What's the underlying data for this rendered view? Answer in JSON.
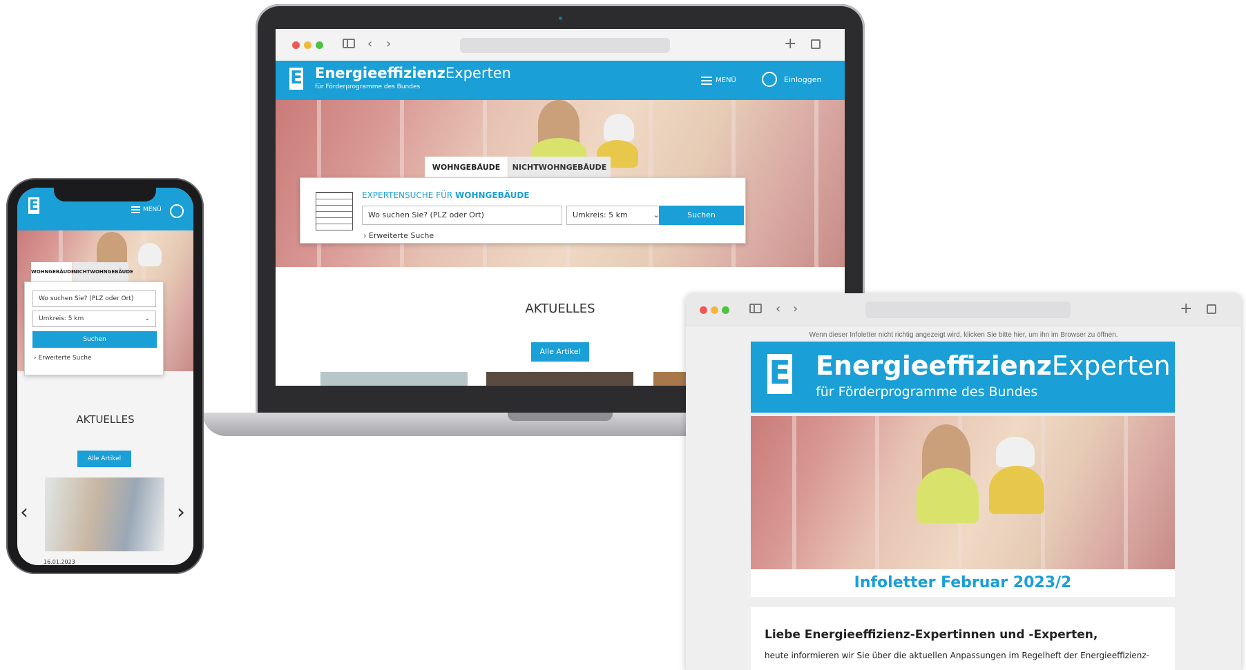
{
  "laptop": {
    "brand_bold": "Energieeffizienz",
    "brand_rest": "Experten",
    "brand_sub": "für Förderprogramme des Bundes",
    "menu_label": "MENÜ",
    "login_label": "Einloggen",
    "tab_residential": "WOHNGEBÄUDE",
    "tab_nonresidential": "NICHTWOHNGEBÄUDE",
    "search_title_prefix": "EXPERTENSUCHE FÜR ",
    "search_title_bold": "WOHNGEBÄUDE",
    "location_placeholder": "Wo suchen Sie? (PLZ oder Ort)",
    "radius_value": "Umkreis: 5 km",
    "search_button": "Suchen",
    "advanced_search": "Erweiterte Suche",
    "news_heading": "AKTUELLES",
    "all_articles": "Alle Artikel"
  },
  "phone": {
    "menu_label": "MENÜ",
    "tab_residential": "WOHNGEBÄUDE",
    "tab_nonresidential": "NICHTWOHNGEBÄUDE",
    "location_placeholder": "Wo suchen Sie? (PLZ oder Ort)",
    "radius_value": "Umkreis: 5 km",
    "search_button": "Suchen",
    "advanced_search": "Erweiterte Suche",
    "news_heading": "AKTUELLES",
    "all_articles": "Alle Artikel",
    "article_date": "16.01.2023"
  },
  "newsletter": {
    "notice": "Wenn dieser Infoletter nicht richtig angezeigt wird, klicken Sie bitte hier, um ihn im Browser zu öffnen.",
    "brand_bold": "Energieeffizienz",
    "brand_rest": "Experten",
    "brand_sub": "für Förderprogramme des Bundes",
    "issue_title": "Infoletter Februar 2023/2",
    "greeting": "Liebe Energieeffizienz-Expertinnen und -Experten,",
    "intro": "heute informieren wir Sie über die aktuellen Anpassungen im Regelheft der Energieeffizienz-"
  },
  "colors": {
    "brand_blue": "#1a9fd6",
    "traffic_red": "#ee5a52",
    "traffic_yellow": "#f5b93a",
    "traffic_green": "#4fc243"
  },
  "icons": [
    "sidebar-icon",
    "chevron-left-icon",
    "chevron-right-icon",
    "plus-icon",
    "tabs-icon",
    "hamburger-icon",
    "user-icon",
    "chevron-down-icon",
    "building-icon"
  ]
}
